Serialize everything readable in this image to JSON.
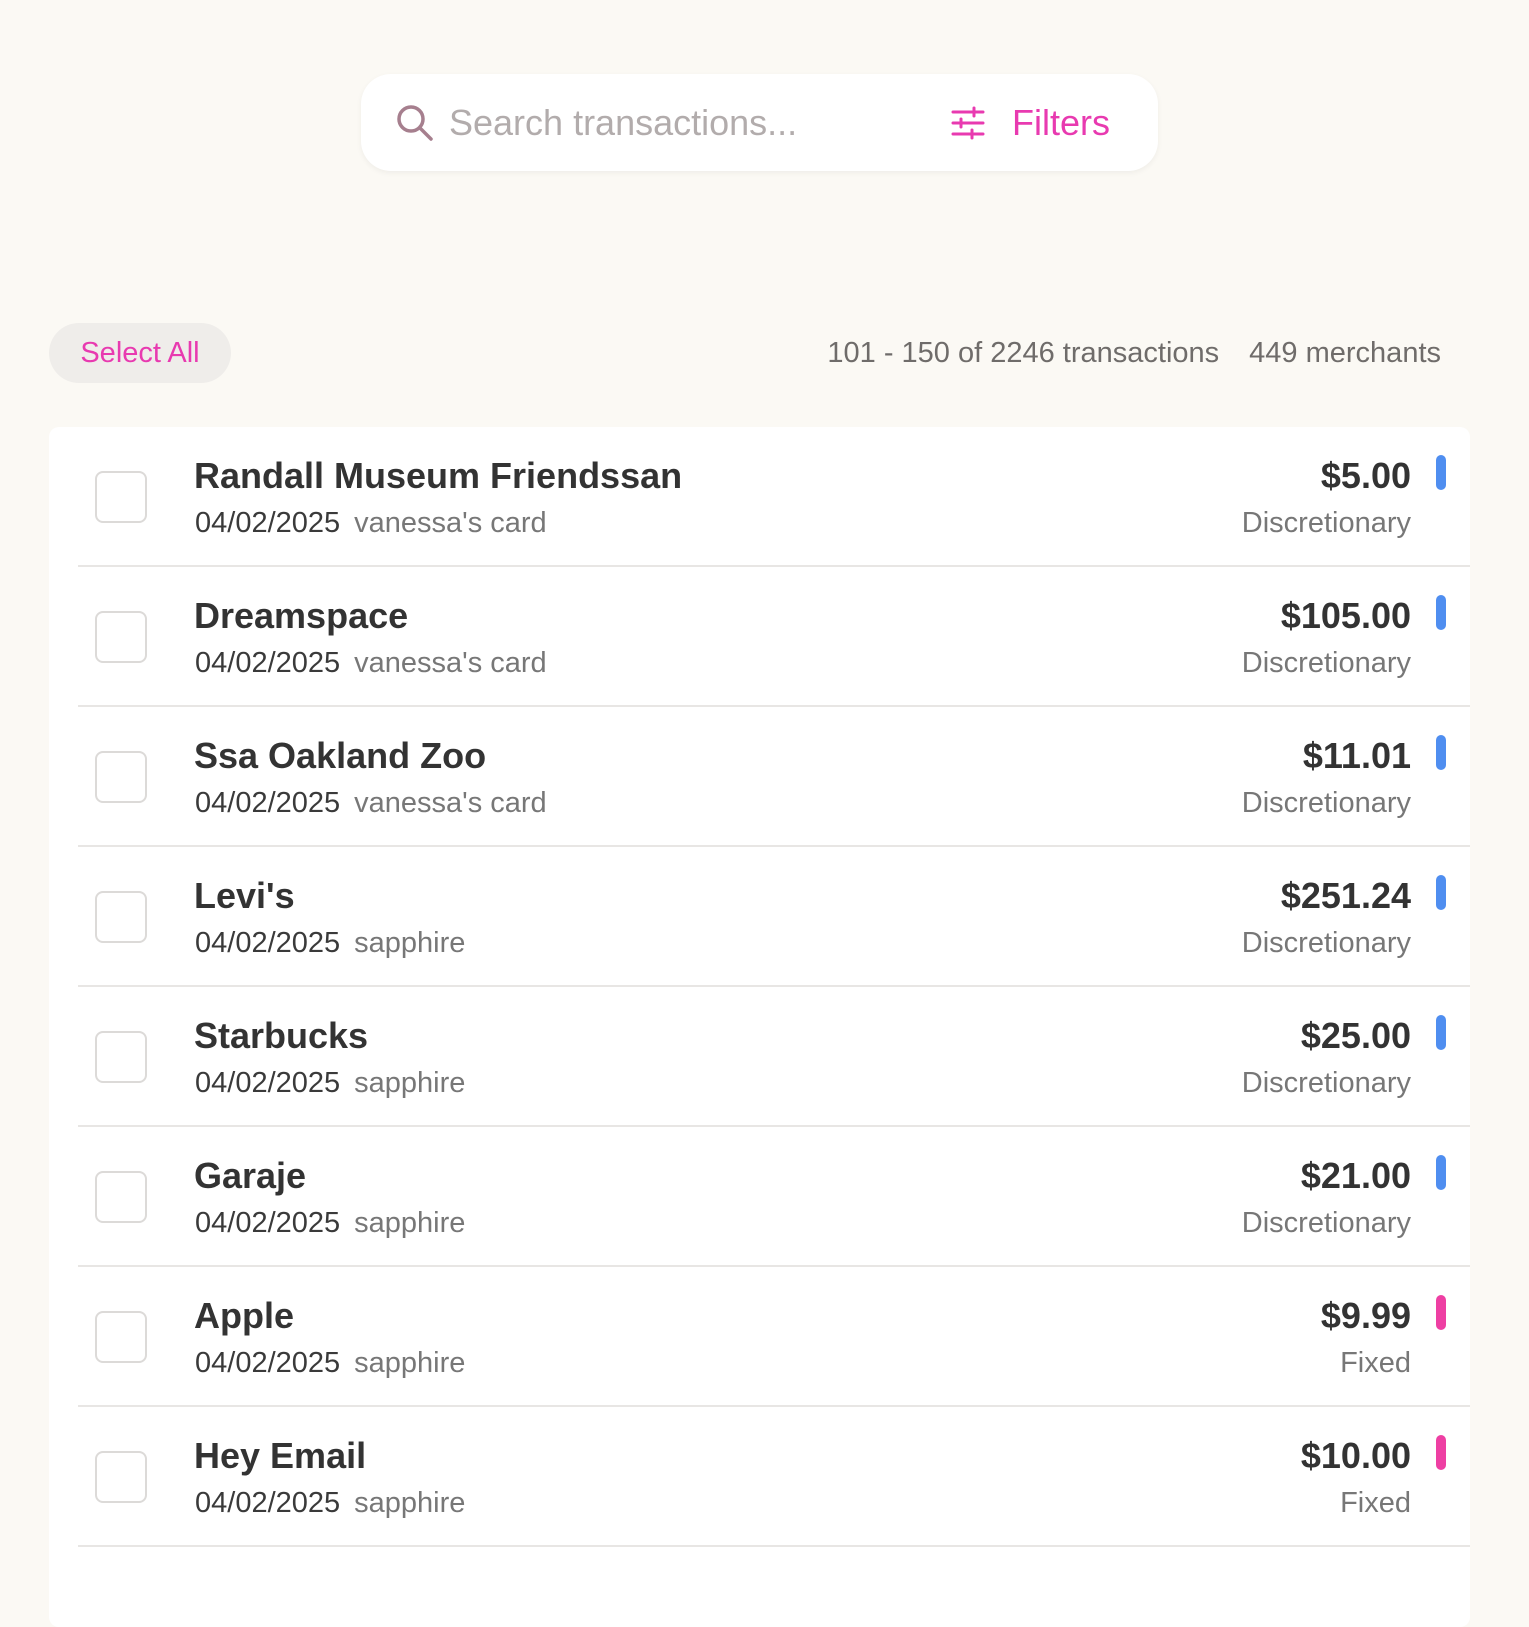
{
  "search": {
    "placeholder": "Search transactions...",
    "filters_label": "Filters",
    "accent_color": "#e83ab0"
  },
  "toolbar": {
    "select_all_label": "Select All",
    "range_text": "101 - 150 of 2246 transactions",
    "merchants_text": "449 merchants"
  },
  "category_colors": {
    "Discretionary": "#4f8ef0",
    "Fixed": "#ee3fa3"
  },
  "transactions": [
    {
      "merchant": "Randall Museum Friendssan",
      "date": "04/02/2025",
      "card": "vanessa's card",
      "amount": "$5.00",
      "category": "Discretionary"
    },
    {
      "merchant": "Dreamspace",
      "date": "04/02/2025",
      "card": "vanessa's card",
      "amount": "$105.00",
      "category": "Discretionary"
    },
    {
      "merchant": "Ssa Oakland Zoo",
      "date": "04/02/2025",
      "card": "vanessa's card",
      "amount": "$11.01",
      "category": "Discretionary"
    },
    {
      "merchant": "Levi's",
      "date": "04/02/2025",
      "card": "sapphire",
      "amount": "$251.24",
      "category": "Discretionary"
    },
    {
      "merchant": "Starbucks",
      "date": "04/02/2025",
      "card": "sapphire",
      "amount": "$25.00",
      "category": "Discretionary"
    },
    {
      "merchant": "Garaje",
      "date": "04/02/2025",
      "card": "sapphire",
      "amount": "$21.00",
      "category": "Discretionary"
    },
    {
      "merchant": "Apple",
      "date": "04/02/2025",
      "card": "sapphire",
      "amount": "$9.99",
      "category": "Fixed"
    },
    {
      "merchant": "Hey Email",
      "date": "04/02/2025",
      "card": "sapphire",
      "amount": "$10.00",
      "category": "Fixed"
    }
  ]
}
